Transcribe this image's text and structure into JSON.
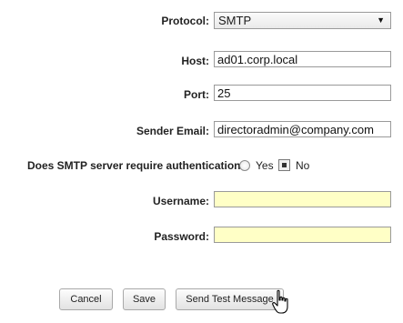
{
  "protocol": {
    "label": "Protocol:",
    "value": "SMTP",
    "icon": "chevron-down-icon"
  },
  "host": {
    "label": "Host:",
    "value": "ad01.corp.local"
  },
  "port": {
    "label": "Port:",
    "value": "25"
  },
  "sender_email": {
    "label": "Sender Email:",
    "value": "directoradmin@company.com"
  },
  "auth": {
    "question": "Does SMTP server require authentication",
    "yes_label": "Yes",
    "no_label": "No",
    "selected": "No"
  },
  "username": {
    "label": "Username:",
    "value": ""
  },
  "password": {
    "label": "Password:",
    "value": ""
  },
  "buttons": {
    "cancel": "Cancel",
    "save": "Save",
    "send_test": "Send Test Message"
  },
  "colors": {
    "credential_field_bg": "#ffffc6",
    "button_gradient_top": "#fdfdfd",
    "button_gradient_bottom": "#e2e2e2"
  }
}
